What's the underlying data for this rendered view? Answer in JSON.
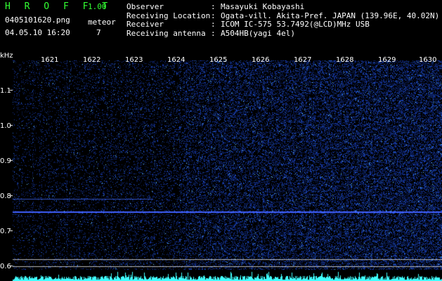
{
  "app": {
    "title": "H R O F F T",
    "version": "1.00"
  },
  "file": {
    "name": "0405101620.png",
    "datetime": "04.05.10 16:20"
  },
  "meteor": {
    "label": "meteor",
    "count": "7"
  },
  "info": [
    {
      "key": "Observer",
      "value": "Masayuki Kobayashi"
    },
    {
      "key": "Receiving Location",
      "value": "Ogata-vill. Akita-Pref. JAPAN (139.96E, 40.02N)"
    },
    {
      "key": "Receiver",
      "value": "ICOM IC-575 53.7492(@LCD)MHz USB"
    },
    {
      "key": "Receiving antenna",
      "value": "A504HB(yagi 4el)"
    }
  ],
  "spectrogram": {
    "freq_unit": "kHz",
    "freq_ticks": [
      "1.1",
      "1.0",
      "0.9",
      "0.8",
      "0.7",
      "0.6"
    ],
    "time_ticks": [
      "1621",
      "1622",
      "1623",
      "1624",
      "1625",
      "1626",
      "1627",
      "1628",
      "1629",
      "1630"
    ],
    "colors": {
      "background": "#000000",
      "signal": "#2040d0",
      "bright": "#80e0ff",
      "carrier": "#4060ff",
      "baseline": "#40ffff"
    }
  }
}
